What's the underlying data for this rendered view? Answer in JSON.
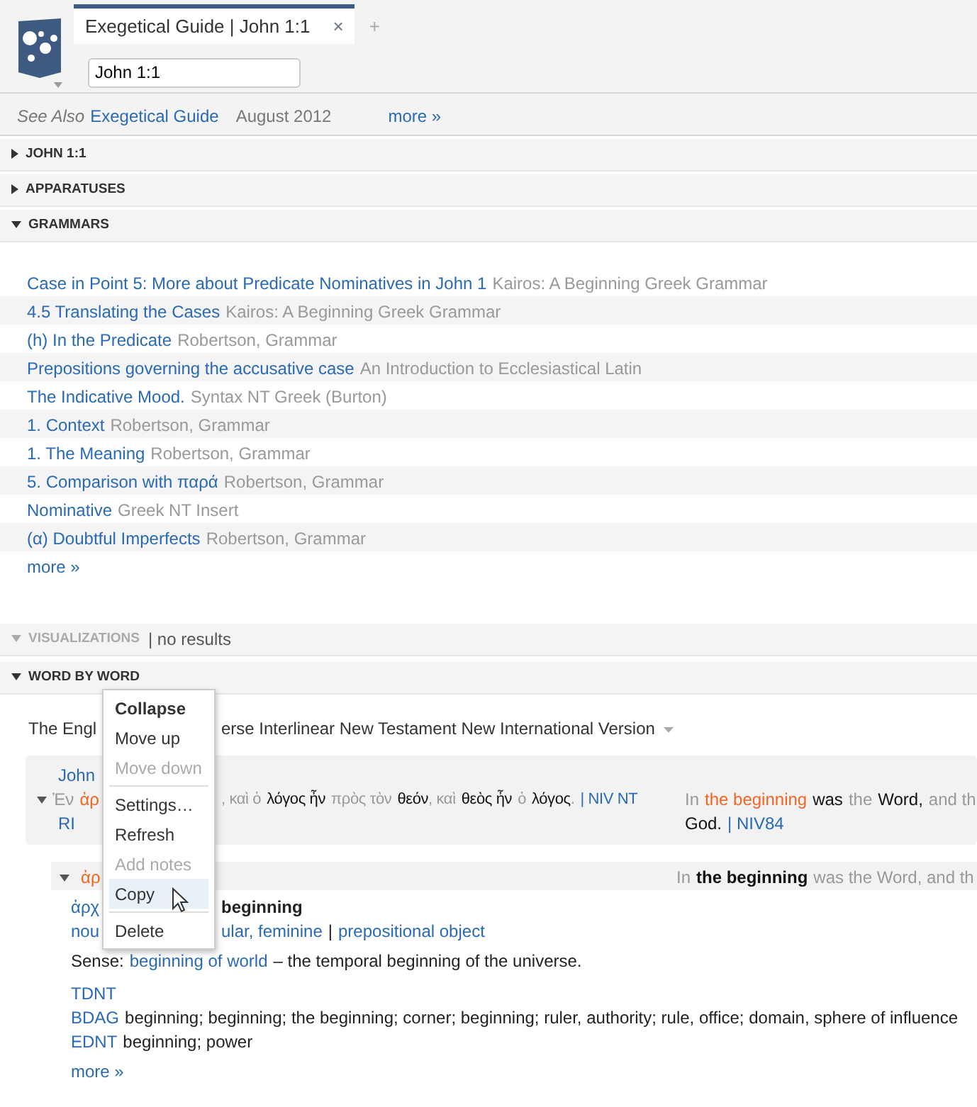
{
  "tab": {
    "title": "Exegetical Guide | John 1:1",
    "close": "×",
    "new_tab": "+",
    "selected": true
  },
  "reference": {
    "value": "John 1:1"
  },
  "see_also": {
    "label": "See Also",
    "links": [
      "Exegetical Guide"
    ],
    "date": "August 2012",
    "more": "more »"
  },
  "sections": [
    {
      "kind": "header",
      "title": "JOHN 1:1",
      "expanded": false,
      "disabled": false
    },
    {
      "kind": "header",
      "title": "APPARATUSES",
      "expanded": false,
      "disabled": false
    },
    {
      "kind": "grammars",
      "title": "GRAMMARS",
      "expanded": true,
      "disabled": false,
      "items": [
        {
          "title": "Case in Point 5: More about Predicate Nominatives in John 1",
          "source": "Kairos: A Beginning Greek Grammar"
        },
        {
          "title": "4.5 Translating the Cases",
          "source": "Kairos: A Beginning Greek Grammar"
        },
        {
          "title": "(h) In the Predicate",
          "source": "Robertson, Grammar"
        },
        {
          "title": "Prepositions governing the accusative case",
          "source": "An Introduction to Ecclesiastical Latin"
        },
        {
          "title": "The Indicative Mood.",
          "source": "Syntax NT Greek (Burton)"
        },
        {
          "title": "1. Context",
          "source": "Robertson, Grammar"
        },
        {
          "title": "1. The Meaning",
          "source": "Robertson, Grammar"
        },
        {
          "title": "5. Comparison with παρά",
          "source": "Robertson, Grammar"
        },
        {
          "title": "Nominative",
          "source": "Greek NT Insert"
        },
        {
          "title": "(α) Doubtful Imperfects",
          "source": "Robertson, Grammar"
        }
      ],
      "more": "more »"
    },
    {
      "kind": "header",
      "title": "VISUALIZATIONS",
      "expanded": true,
      "disabled": true,
      "note": "| no results"
    },
    {
      "kind": "wordbyword",
      "title": "WORD BY WORD",
      "expanded": true,
      "disabled": false,
      "versions": [
        "The Engl",
        "erse Interlinear New Testament New International Version"
      ],
      "verse": {
        "reference": "John",
        "greek_start": [
          {
            "kind": "function",
            "text": "Ἐν"
          },
          {
            "kind": "highlight",
            "text": "ἀρ"
          }
        ],
        "greek_rest": [
          {
            "kind": "function",
            "text": ", καὶ ὁ"
          },
          {
            "kind": "content",
            "text": "λόγος ἦν"
          },
          {
            "kind": "function",
            "text": "πρὸς τὸν"
          },
          {
            "kind": "content",
            "text": "θεόν"
          },
          {
            "kind": "function",
            "text": ", καὶ"
          },
          {
            "kind": "content",
            "text": "θεὸς ἦν"
          },
          {
            "kind": "function",
            "text": "ὁ"
          },
          {
            "kind": "content",
            "text": "λόγος"
          },
          {
            "kind": "function",
            "text": "."
          }
        ],
        "greek_version": [
          "| NIV NT",
          "RI"
        ],
        "english": [
          {
            "kind": "function",
            "text": "In"
          },
          {
            "kind": "highlight",
            "text": "the beginning"
          },
          {
            "kind": "content",
            "text": "was"
          },
          {
            "kind": "function",
            "text": "the"
          },
          {
            "kind": "content",
            "text": "Word,"
          },
          {
            "kind": "function",
            "text": "and th"
          }
        ],
        "english_line2": "God.",
        "english_version": "| NIV84"
      },
      "word": {
        "lemma_start": "ἀρ",
        "expanded": true,
        "english": [
          {
            "kind": "function",
            "text": "In"
          },
          {
            "kind": "strong",
            "text": "the beginning"
          },
          {
            "kind": "function",
            "text": "was the Word, and th"
          }
        ],
        "lemma": "ἀρχ",
        "gloss": "beginning",
        "morph_start": "nou",
        "morph_rest": "ular, feminine",
        "separator": "|",
        "role": "prepositional object",
        "sense_label": "Sense:",
        "sense": "beginning of world",
        "sense_def": "– the temporal beginning of the universe.",
        "lexicons": [
          {
            "name": "TDNT"
          },
          {
            "name": "BDAG",
            "gloss": "beginning; beginning; the beginning; corner; beginning; ruler, authority; rule, office; domain, sphere of influence"
          },
          {
            "name": "EDNT",
            "gloss": "beginning; power"
          }
        ],
        "more": "more »"
      }
    }
  ],
  "context_menu": [
    [
      {
        "label": "Collapse",
        "default": true,
        "disabled": false,
        "selected": false
      },
      {
        "label": "Move up",
        "default": false,
        "disabled": false,
        "selected": false
      },
      {
        "label": "Move down",
        "default": false,
        "disabled": true,
        "selected": false
      }
    ],
    [
      {
        "label": "Settings…",
        "default": false,
        "disabled": false,
        "selected": false
      },
      {
        "label": "Refresh",
        "default": false,
        "disabled": false,
        "selected": false
      },
      {
        "label": "Add notes",
        "default": false,
        "disabled": true,
        "selected": false
      },
      {
        "label": "Copy",
        "default": false,
        "disabled": false,
        "selected": true
      }
    ],
    [
      {
        "label": "Delete",
        "default": false,
        "disabled": false,
        "selected": false
      }
    ]
  ]
}
